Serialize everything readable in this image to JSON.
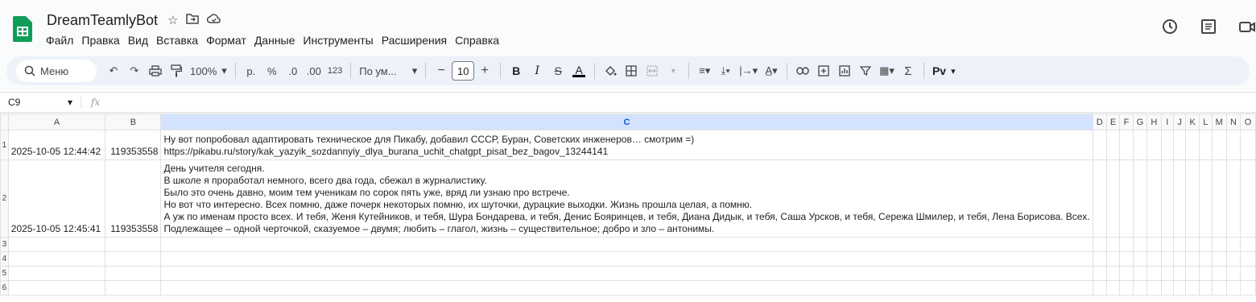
{
  "app": {
    "title": "DreamTeamlyBot",
    "menu": [
      "Файл",
      "Правка",
      "Вид",
      "Вставка",
      "Формат",
      "Данные",
      "Инструменты",
      "Расширения",
      "Справка"
    ]
  },
  "toolbar": {
    "search_label": "Меню",
    "zoom": "100%",
    "currency": "р.",
    "percent": "%",
    "dec_decrease": ".0",
    "dec_increase": ".00",
    "format_123": "123",
    "font": "По ум...",
    "font_size": "10",
    "bold": "B",
    "italic": "I",
    "text_color": "A",
    "sum": "Σ",
    "input_tools": "Pv"
  },
  "formula_bar": {
    "cell_ref": "C9",
    "fx": "fx",
    "value": ""
  },
  "sheet": {
    "columns": [
      "A",
      "B",
      "C",
      "D",
      "E",
      "F",
      "G",
      "H",
      "I",
      "J",
      "K",
      "L",
      "M",
      "N",
      "O"
    ],
    "selected_column": "C",
    "rows": [
      {
        "num": "1",
        "a": "2025-10-05 12:44:42",
        "b": "119353558",
        "c": "Ну вот попробовал адаптировать техническое для Пикабу, добавил СССР, Буран, Советских инженеров… смотрим =)\nhttps://pikabu.ru/story/kak_yazyik_sozdannyiy_dlya_burana_uchit_chatgpt_pisat_bez_bagov_13244141"
      },
      {
        "num": "2",
        "a": "2025-10-05 12:45:41",
        "b": "119353558",
        "c": "День учителя сегодня.\nВ школе я проработал немного, всего два года, сбежал в журналистику.\nБыло это очень давно, моим тем ученикам по сорок пять уже, вряд ли узнаю про встрече.\nНо вот что интересно. Всех помню, даже почерк некоторых помню, их шуточки, дурацкие выходки. Жизнь прошла целая, а помню.\nА уж по именам просто всех. И тебя, Женя Кутейников, и тебя, Шура Бондарева, и тебя, Денис Бояринцев, и тебя, Диана Дидык, и тебя, Саша Урсков, и тебя, Сережа Шмилер, и тебя, Лена Борисова. Всех.\nПодлежащее – одной черточкой, сказуемое – двумя; любить – глагол, жизнь – существительное; добро и зло – антонимы."
      },
      {
        "num": "3",
        "a": "",
        "b": "",
        "c": ""
      },
      {
        "num": "4",
        "a": "",
        "b": "",
        "c": ""
      },
      {
        "num": "5",
        "a": "",
        "b": "",
        "c": ""
      },
      {
        "num": "6",
        "a": "",
        "b": "",
        "c": ""
      }
    ]
  }
}
